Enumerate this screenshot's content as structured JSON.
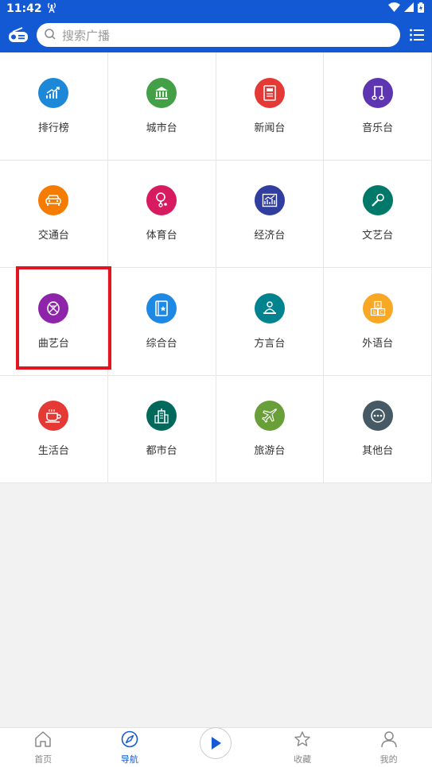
{
  "status": {
    "time": "11:42"
  },
  "search": {
    "placeholder": "搜索广播"
  },
  "grid": [
    {
      "label": "排行榜",
      "color": "#1e88d8",
      "icon": "chart-up-icon"
    },
    {
      "label": "城市台",
      "color": "#43a047",
      "icon": "building-icon"
    },
    {
      "label": "新闻台",
      "color": "#e53935",
      "icon": "newspaper-icon"
    },
    {
      "label": "音乐台",
      "color": "#5e35b1",
      "icon": "music-note-icon"
    },
    {
      "label": "交通台",
      "color": "#f57c00",
      "icon": "car-icon"
    },
    {
      "label": "体育台",
      "color": "#d81b60",
      "icon": "racket-icon"
    },
    {
      "label": "经济台",
      "color": "#303f9f",
      "icon": "chart-icon"
    },
    {
      "label": "文艺台",
      "color": "#00796b",
      "icon": "microphone-icon"
    },
    {
      "label": "曲艺台",
      "color": "#8e24aa",
      "icon": "opera-mask-icon"
    },
    {
      "label": "综合台",
      "color": "#1e88e5",
      "icon": "book-icon"
    },
    {
      "label": "方言台",
      "color": "#00838f",
      "icon": "speaker-person-icon"
    },
    {
      "label": "外语台",
      "color": "#f9a825",
      "icon": "abc-blocks-icon"
    },
    {
      "label": "生活台",
      "color": "#e53935",
      "icon": "coffee-icon"
    },
    {
      "label": "都市台",
      "color": "#00695c",
      "icon": "city-icon"
    },
    {
      "label": "旅游台",
      "color": "#689f38",
      "icon": "airplane-icon"
    },
    {
      "label": "其他台",
      "color": "#455a64",
      "icon": "more-icon"
    }
  ],
  "bottomnav": [
    {
      "label": "首页",
      "icon": "home-icon"
    },
    {
      "label": "导航",
      "icon": "compass-icon",
      "active": true
    },
    {
      "label": "",
      "icon": "play-icon"
    },
    {
      "label": "收藏",
      "icon": "star-icon"
    },
    {
      "label": "我的",
      "icon": "user-icon"
    }
  ]
}
